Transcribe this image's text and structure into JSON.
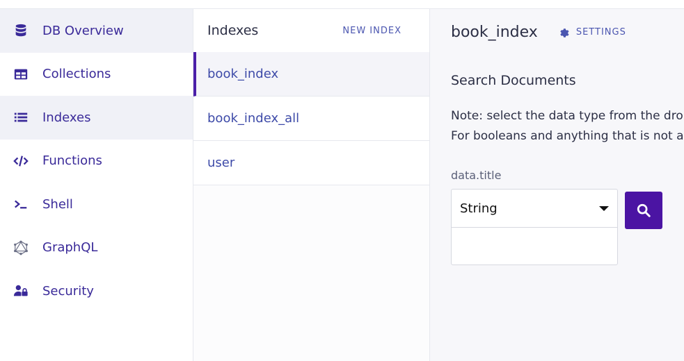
{
  "sidebar": {
    "items": [
      {
        "label": "DB Overview",
        "icon": "database-icon",
        "active": true
      },
      {
        "label": "Collections",
        "icon": "table-icon",
        "active": false
      },
      {
        "label": "Indexes",
        "icon": "list-icon",
        "active": true
      },
      {
        "label": "Functions",
        "icon": "code-icon",
        "active": false
      },
      {
        "label": "Shell",
        "icon": "terminal-icon",
        "active": false
      },
      {
        "label": "GraphQL",
        "icon": "graphql-icon",
        "active": false
      },
      {
        "label": "Security",
        "icon": "user-lock-icon",
        "active": false
      }
    ]
  },
  "indexes": {
    "title": "Indexes",
    "new_label": "NEW INDEX",
    "items": [
      "book_index",
      "book_index_all",
      "user"
    ]
  },
  "main": {
    "title": "book_index",
    "settings_label": "SETTINGS",
    "section_title": "Search Documents",
    "note_line1": "Note: select the data type from the dro",
    "note_line2": "For booleans and anything that is not a",
    "field_label": "data.title",
    "type_selected": "String",
    "value": "",
    "value_placeholder": ""
  },
  "colors": {
    "accent": "#4b14a3",
    "link": "#3d4aa8",
    "sidebar_text": "#3a2a99"
  }
}
